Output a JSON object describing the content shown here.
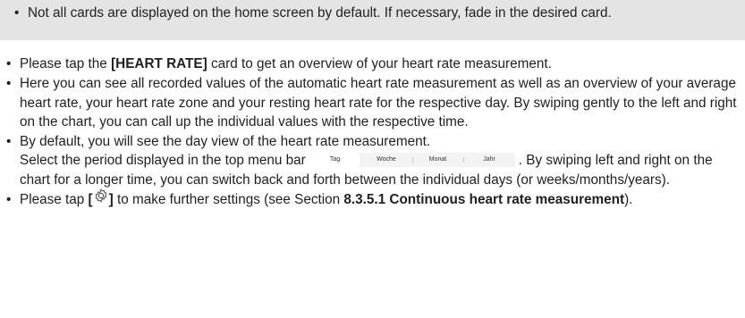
{
  "note": {
    "bullet": "•",
    "text": "Not all cards are displayed on the home screen by default. If necessary, fade in the desired card."
  },
  "items": [
    {
      "bullet": "•",
      "pre": "Please tap the ",
      "bold": "[HEART RATE]",
      "post": " card to get an overview of your heart rate measurement."
    },
    {
      "bullet": "•",
      "text": "Here you can see all recorded values of the automatic heart rate measurement as well as an overview of your average heart rate, your heart rate zone and your resting heart rate for the respective day. By swiping gently to the left and right on the chart, you can call up the individual values with the respective time."
    },
    {
      "bullet": "•",
      "line1": "By default, you will see the day view of the heart rate measurement.",
      "pre_bar": "Select the period displayed in the top menu bar",
      "post_bar": ". By swiping left and right on the chart for a longer time, you can switch back and forth between the individual days (or weeks/months/years)."
    },
    {
      "bullet": "•",
      "pre": "Please tap ",
      "bracket_open": "[",
      "bracket_close": "]",
      "mid": " to make further settings (see Section ",
      "bold": "8.3.5.1 Continuous heart rate measurement",
      "post": ")."
    }
  ],
  "period_bar": {
    "tabs": [
      "Tag",
      "Woche",
      "Monat",
      "Jahr"
    ],
    "selected": "Tag"
  },
  "icons": {
    "settings": "gear-icon"
  }
}
